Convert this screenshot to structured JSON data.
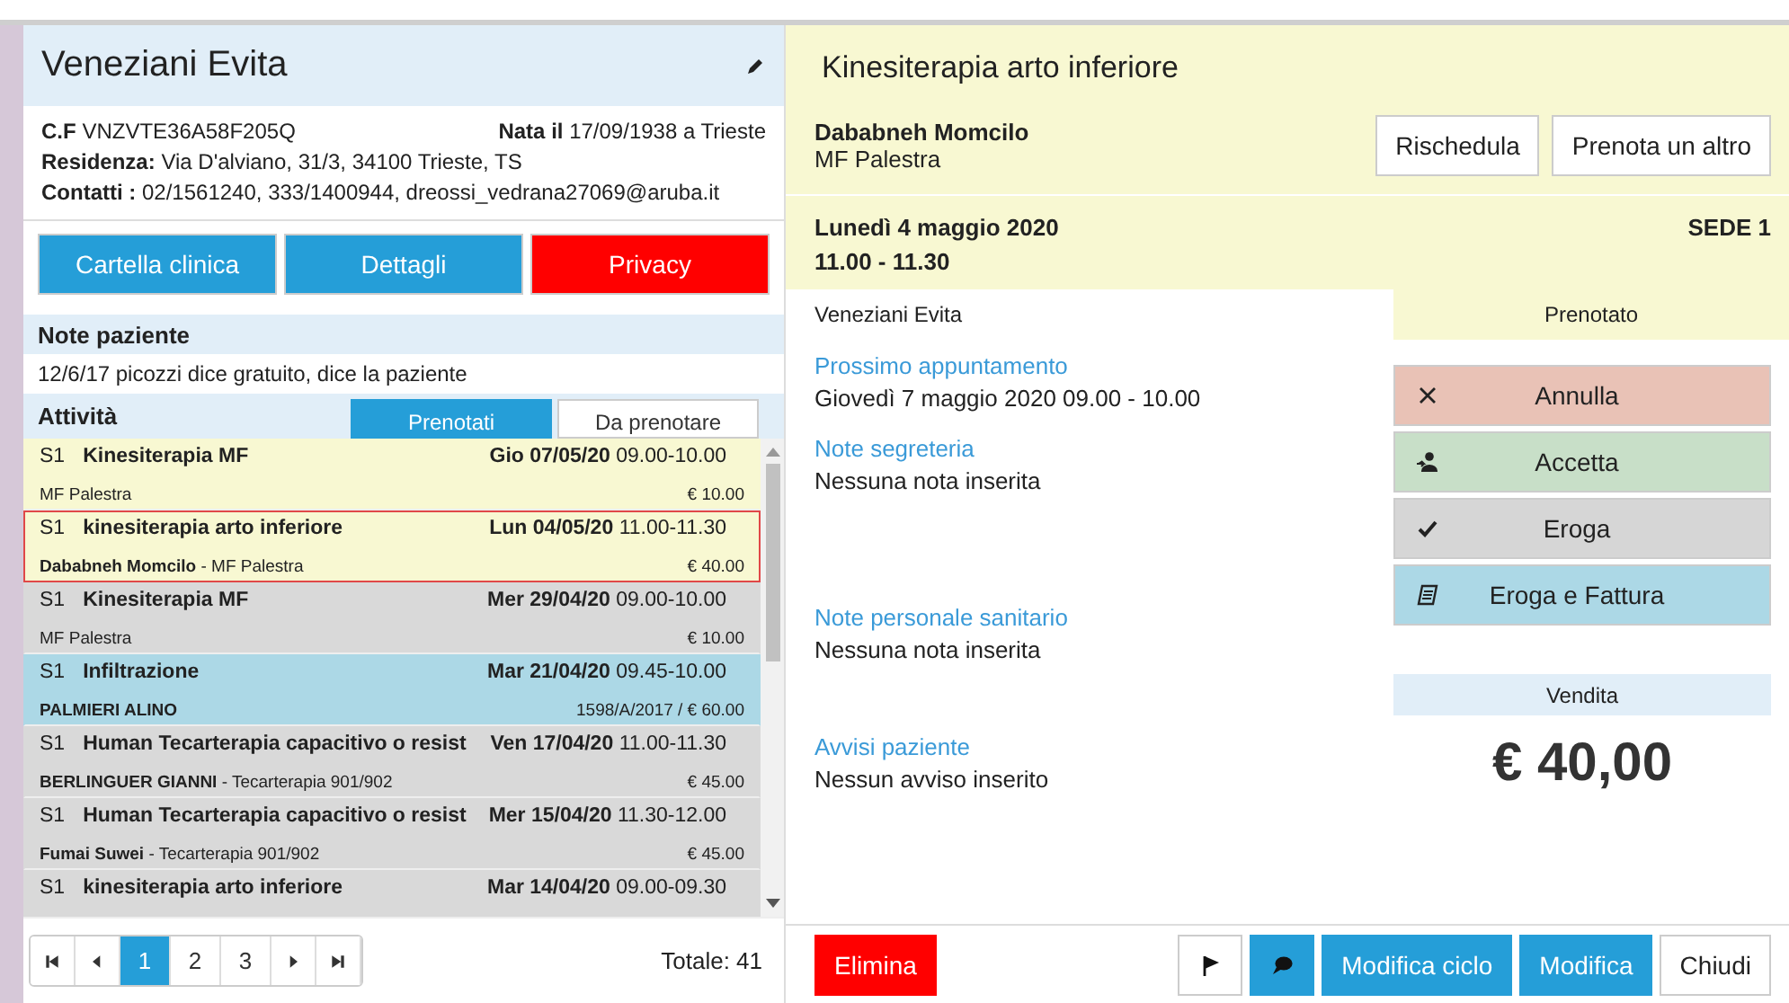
{
  "patient": {
    "name": "Veneziani Evita",
    "cf_label": "C.F",
    "cf": "VNZVTE36A58F205Q",
    "born_label": "Nata il",
    "born": "17/09/1938 a Trieste",
    "residence_label": "Residenza:",
    "residence": "Via D'alviano, 31/3, 34100 Trieste, TS",
    "contacts_label": "Contatti :",
    "contacts": "02/1561240, 333/1400944, dreossi_vedrana27069@aruba.it"
  },
  "patient_buttons": [
    {
      "label": "Cartella clinica",
      "kind": "primary"
    },
    {
      "label": "Dettagli",
      "kind": "primary"
    },
    {
      "label": "Privacy",
      "kind": "danger"
    }
  ],
  "notes": {
    "title": "Note paziente",
    "text": "12/6/17 picozzi dice gratuito, dice la paziente"
  },
  "activities": {
    "title": "Attività",
    "tabs": [
      {
        "label": "Prenotati",
        "selected": true
      },
      {
        "label": "Da prenotare",
        "selected": false
      }
    ],
    "rows": [
      {
        "code": "S1",
        "title": "Kinesiterapia MF",
        "day": "Gio 07/05/20",
        "time": "09.00-10.00",
        "detail": "MF Palestra",
        "price": "€ 10.00",
        "color": "#f8f8d2",
        "selected": false
      },
      {
        "code": "S1",
        "title": "kinesiterapia arto inferiore",
        "day": "Lun 04/05/20",
        "time": "11.00-11.30",
        "detail": "**Dababneh Momcilo** - MF Palestra",
        "price": "€ 40.00",
        "color": "#f8f8d2",
        "selected": true
      },
      {
        "code": "S1",
        "title": "Kinesiterapia MF",
        "day": "Mer 29/04/20",
        "time": "09.00-10.00",
        "detail": "MF Palestra",
        "price": "€ 10.00",
        "color": "#d9d9d9",
        "selected": false
      },
      {
        "code": "S1",
        "title": "Infiltrazione",
        "day": "Mar 21/04/20",
        "time": "09.45-10.00",
        "detail": "PALMIERI ALINO",
        "detail_bold": true,
        "price": "1598/A/2017 / € 60.00",
        "color": "#acd8e6",
        "selected": false
      },
      {
        "code": "S1",
        "title": "Human Tecarterapia capacitivo o resist",
        "day": "Ven 17/04/20",
        "time": "11.00-11.30",
        "detail": "**BERLINGUER GIANNI** - Tecarterapia 901/902",
        "price": "€ 45.00",
        "color": "#d9d9d9",
        "selected": false
      },
      {
        "code": "S1",
        "title": "Human Tecarterapia capacitivo o resist",
        "day": "Mer 15/04/20",
        "time": "11.30-12.00",
        "detail": "**Fumai Suwei** - Tecarterapia 901/902",
        "price": "€ 45.00",
        "color": "#d9d9d9",
        "selected": false
      },
      {
        "code": "S1",
        "title": "kinesiterapia arto inferiore",
        "day": "Mar 14/04/20",
        "time": "09.00-09.30",
        "color": "#d9d9d9",
        "selected": false
      }
    ],
    "pages": [
      {
        "kind": "first"
      },
      {
        "kind": "prev"
      },
      {
        "kind": "page",
        "label": "1",
        "selected": true
      },
      {
        "kind": "page",
        "label": "2",
        "selected": false
      },
      {
        "kind": "page",
        "label": "3",
        "selected": false
      },
      {
        "kind": "next"
      },
      {
        "kind": "last"
      }
    ],
    "total": "Totale: 41"
  },
  "appointment": {
    "title": "Kinesiterapia arto inferiore",
    "operator": "Dababneh Momcilo",
    "place": "MF Palestra",
    "date": "Lunedì 4 maggio 2020",
    "time": "11.00 - 11.30",
    "site": "SEDE 1",
    "patient": "Veneziani Evita",
    "status": "Prenotato"
  },
  "header_buttons": [
    "Rischedula",
    "Prenota un altro"
  ],
  "info": [
    {
      "label": "Prossimo appuntamento",
      "text": "Giovedì 7 maggio 2020 09.00 - 10.00"
    },
    {
      "label": "Note segreteria",
      "text": "Nessuna nota inserita"
    },
    {
      "label": "Note personale sanitario",
      "text": "Nessuna nota inserita"
    },
    {
      "label": "Avvisi paziente",
      "text": "Nessun avviso inserito"
    }
  ],
  "actions": [
    {
      "label": "Annulla",
      "kind": "cancel",
      "color": "#e9c2b6"
    },
    {
      "label": "Accetta",
      "kind": "accept",
      "color": "#c8dfc8"
    },
    {
      "label": "Eroga",
      "kind": "deliver",
      "color": "#d6d6d6"
    },
    {
      "label": "Eroga e Fattura",
      "kind": "invoice",
      "color": "#acd8e6"
    }
  ],
  "sale": {
    "title": "Vendita",
    "amount": "€ 40,00"
  },
  "footer_buttons": [
    {
      "kind": "danger",
      "label": "Elimina"
    },
    {
      "kind": "flag"
    },
    {
      "kind": "comment"
    },
    {
      "kind": "primary",
      "label": "Modifica ciclo"
    },
    {
      "kind": "primary",
      "label": "Modifica"
    },
    {
      "kind": "plain",
      "label": "Chiudi"
    }
  ]
}
